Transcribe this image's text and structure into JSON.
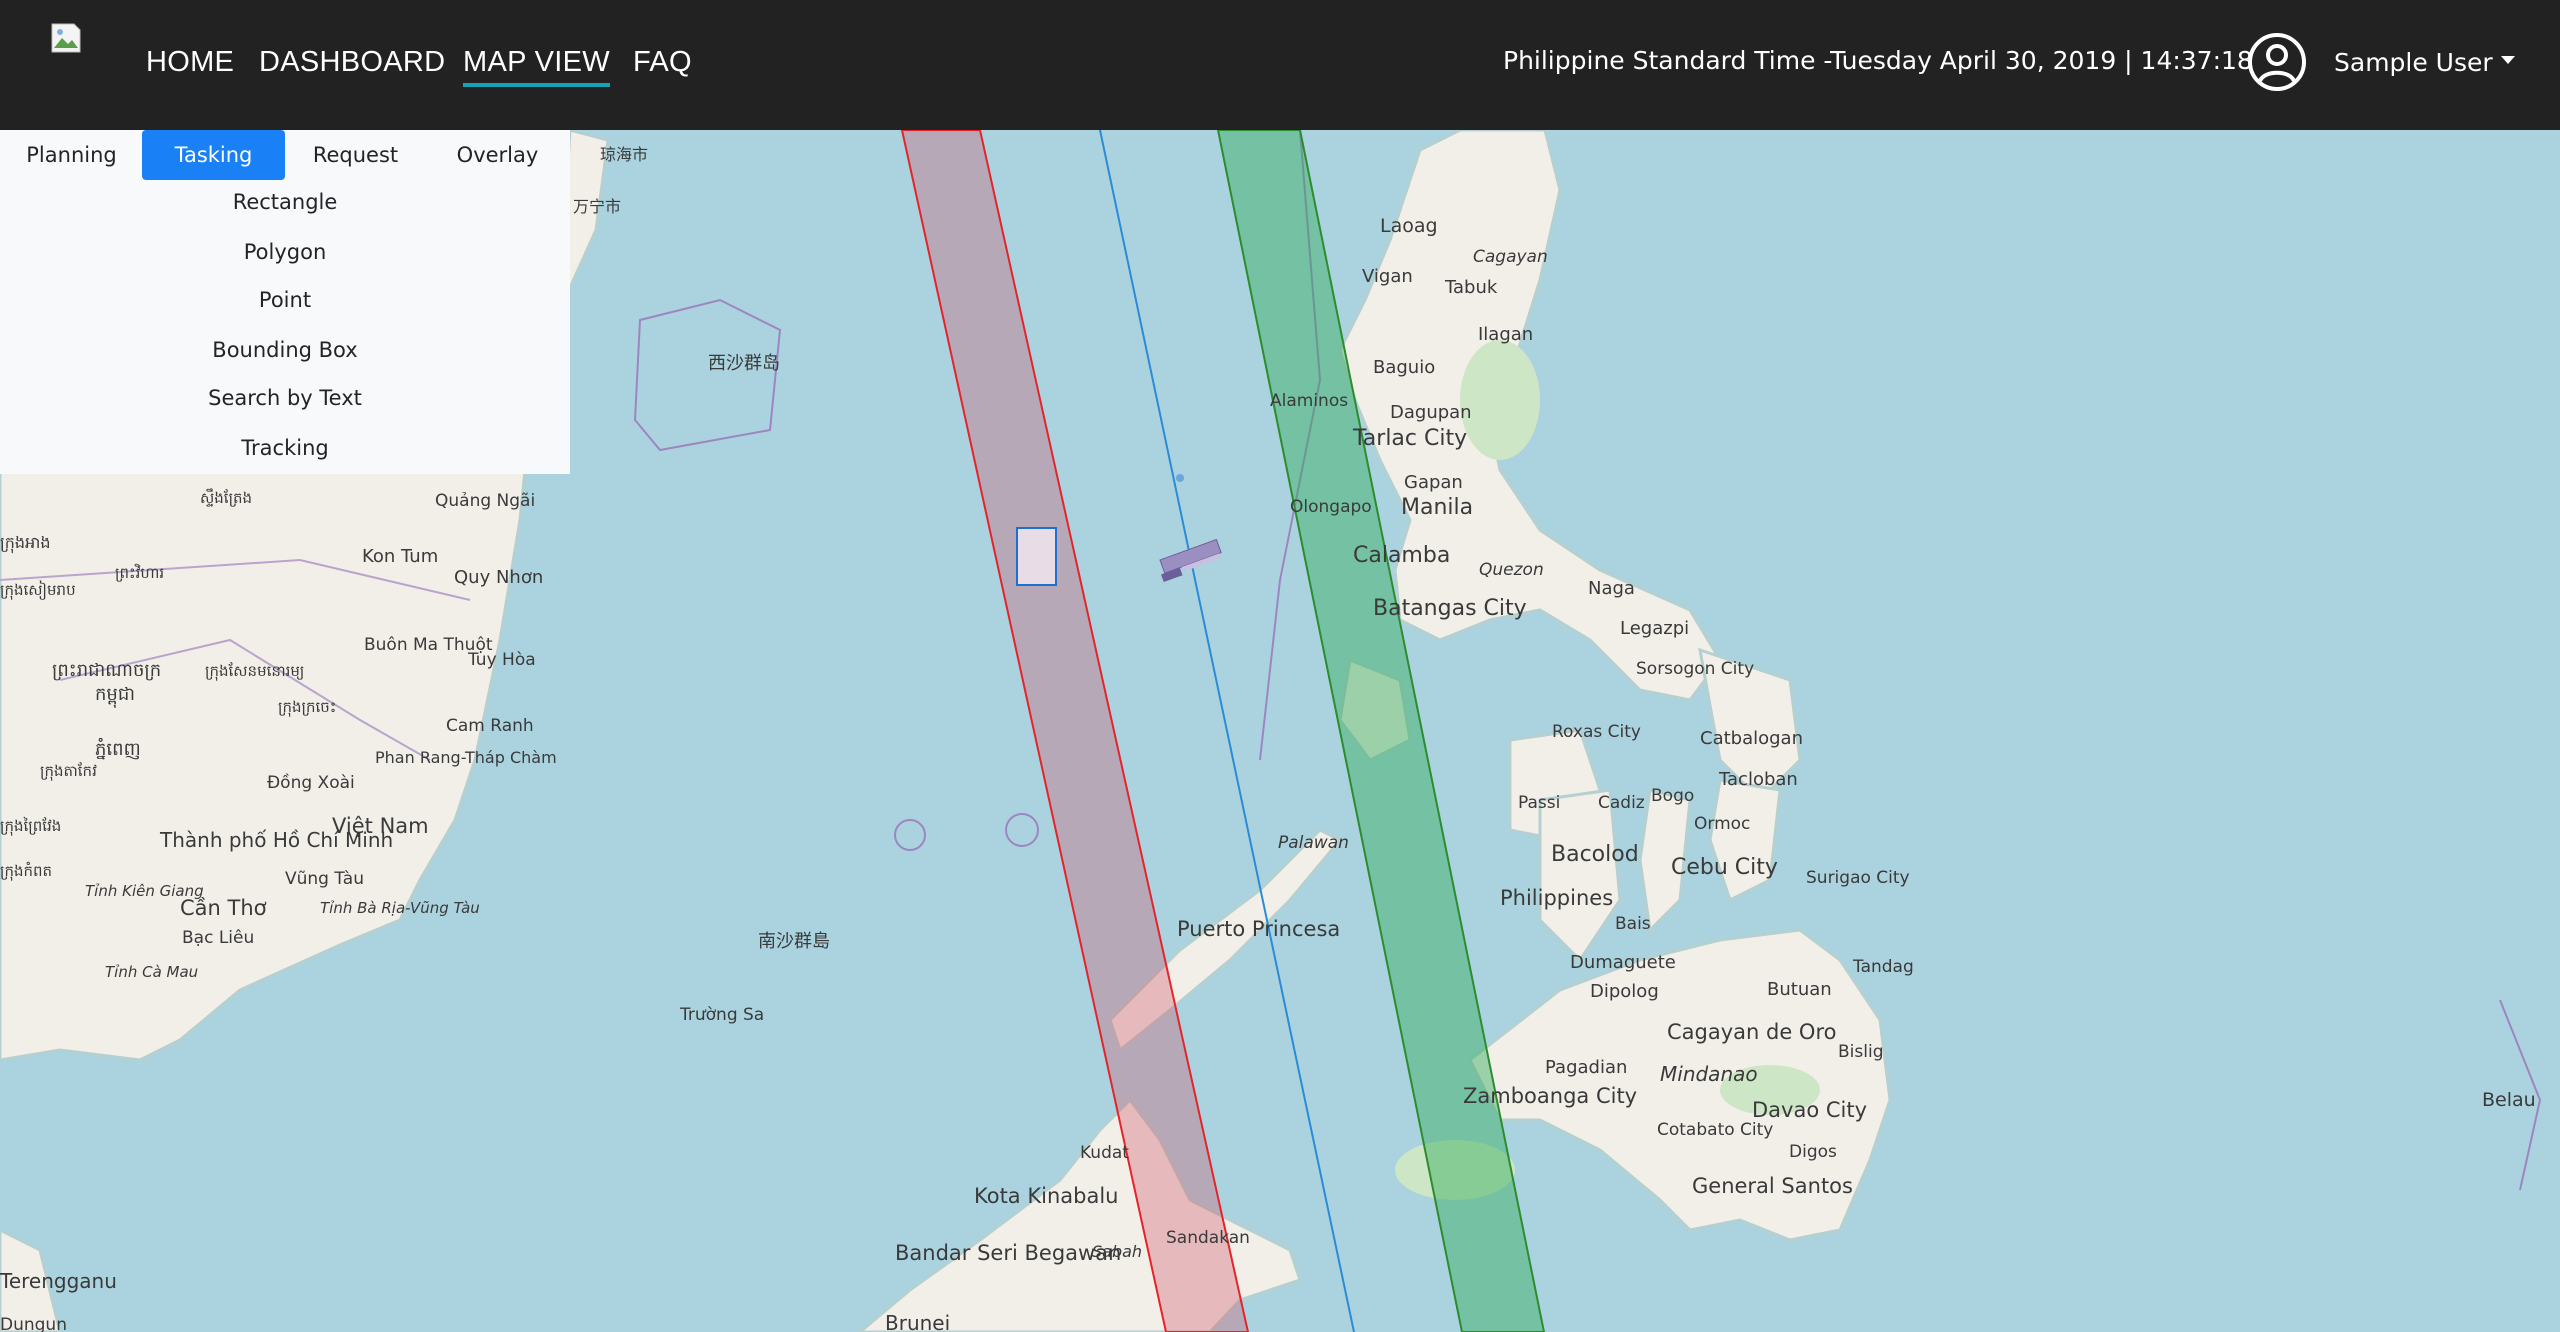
{
  "nav": {
    "links": [
      "HOME",
      "DASHBOARD",
      "MAP VIEW",
      "FAQ"
    ],
    "active": "MAP VIEW",
    "clock": "Philippine Standard Time -Tuesday April 30, 2019 | 14:37:18",
    "user": "Sample User"
  },
  "panel": {
    "tabs": [
      "Planning",
      "Tasking",
      "Request",
      "Overlay"
    ],
    "active_tab": "Tasking",
    "tools": [
      "Rectangle",
      "Polygon",
      "Point",
      "Bounding Box",
      "Search by Text",
      "Tracking"
    ]
  },
  "map": {
    "labels": {
      "laoag": "Laoag",
      "cagayan": "Cagayan",
      "vigan": "Vigan",
      "tabuk": "Tabuk",
      "ilagan": "Ilagan",
      "baguio": "Baguio",
      "alaminos": "Alaminos",
      "dagupan": "Dagupan",
      "tarlac": "Tarlac City",
      "gapan": "Gapan",
      "olongapo": "Olongapo",
      "manila": "Manila",
      "calamba": "Calamba",
      "quezon": "Quezon",
      "batangas": "Batangas City",
      "naga": "Naga",
      "legazpi": "Legazpi",
      "sorsogon": "Sorsogon City",
      "roxas": "Roxas City",
      "catbalogan": "Catbalogan",
      "tacloban": "Tacloban",
      "passi": "Passi",
      "cadiz": "Cadiz",
      "bogo": "Bogo",
      "ormoc": "Ormoc",
      "bacolod": "Bacolod",
      "cebu": "Cebu City",
      "philippines": "Philippines",
      "palawan": "Palawan",
      "puerto": "Puerto Princesa",
      "bais": "Bais",
      "surigao": "Surigao City",
      "tandag": "Tandag",
      "dumaguete": "Dumaguete",
      "dipolog": "Dipolog",
      "butuan": "Butuan",
      "cagayan_oro": "Cagayan de Oro",
      "mindanao": "Mindanao",
      "bislig": "Bislig",
      "pagadian": "Pagadian",
      "zamboanga": "Zamboanga City",
      "davao": "Davao City",
      "cotabato": "Cotabato City",
      "digos": "Digos",
      "gensan": "General Santos",
      "kudat": "Kudat",
      "kota": "Kota Kinabalu",
      "sabah": "Sabah",
      "sandakan": "Sandakan",
      "bandar": "Bandar Seri Begawan",
      "brunei": "Brunei",
      "belau": "Belau",
      "paracel": "西沙群岛",
      "spratly": "南沙群島",
      "truong_sa": "Trường Sa",
      "qionghai": "琼海市",
      "wanning": "万宁市",
      "quang_ngai": "Quảng Ngãi",
      "kon_tum": "Kon Tum",
      "quy_nhon": "Quy Nhơn",
      "buon_ma": "Buôn Ma Thuột",
      "tuy_hoa": "Tuy Hòa",
      "cam_ranh": "Cam Ranh",
      "phan_rang": "Phan Rang-Tháp Chàm",
      "dong_xoai": "Đồng Xoài",
      "vietnam": "Việt Nam",
      "hcm": "Thành phố Hồ Chí Minh",
      "vung_tau": "Vũng Tàu",
      "can_tho": "Cần Thơ",
      "bac_lieu": "Bạc Liêu",
      "tinh_kien": "Tỉnh Kiên Giang",
      "tinh_ba": "Tỉnh Bà Rịa-Vũng Tàu",
      "tinh_ca": "Tỉnh Cà Mau",
      "terengganu": "Terengganu",
      "dungun": "Dungun",
      "km1": "ក្រុងអាង",
      "km2": "ស្ទឹងត្រែង",
      "km3": "ព្រះវិហារ",
      "km4": "ក្រុងសៀមរាប",
      "km5": "ព្រះរាជាណាចក្រ",
      "km6": "កម្ពុជា",
      "km7": "ក្រុងសែនមនោរម្យ",
      "km8": "ភ្នំពេញ",
      "km9": "ក្រុងក្រចេះ",
      "km10": "ក្រុងតាកែវ",
      "km11": "ក្រុងព្រៃវែង",
      "km12": "ក្រុងកំពត"
    }
  }
}
